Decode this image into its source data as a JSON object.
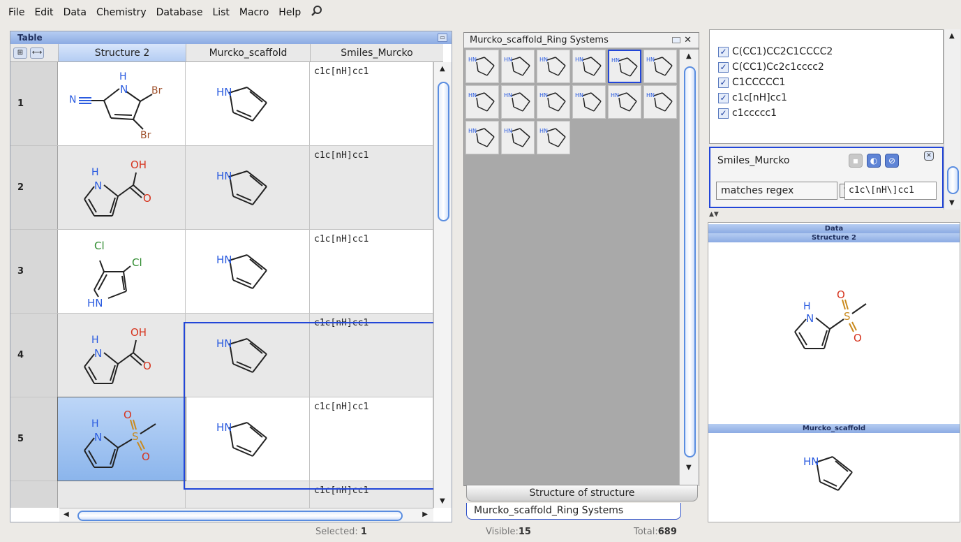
{
  "menu": [
    "File",
    "Edit",
    "Data",
    "Chemistry",
    "Database",
    "List",
    "Macro",
    "Help"
  ],
  "table": {
    "title": "Table",
    "columns": [
      "Structure 2",
      "Murcko_scaffold",
      "Smiles_Murcko"
    ],
    "rows": [
      {
        "num": "1",
        "smiles": "c1c[nH]cc1",
        "mol": {
          "atoms": [
            "H",
            "N",
            "Br",
            "N",
            "Br"
          ]
        }
      },
      {
        "num": "2",
        "smiles": "c1c[nH]cc1",
        "mol": {
          "atoms": [
            "H",
            "N",
            "OH",
            "O"
          ]
        }
      },
      {
        "num": "3",
        "smiles": "c1c[nH]cc1",
        "mol": {
          "atoms": [
            "Cl",
            "Cl",
            "HN"
          ]
        }
      },
      {
        "num": "4",
        "smiles": "c1c[nH]cc1",
        "mol": {
          "atoms": [
            "H",
            "N",
            "OH",
            "O"
          ]
        }
      },
      {
        "num": "5",
        "smiles": "c1c[nH]cc1",
        "mol": {
          "atoms": [
            "H",
            "N",
            "O",
            "S",
            "O"
          ]
        }
      },
      {
        "num": "",
        "smiles": "c1c[nH]cc1"
      }
    ],
    "scaffold_label": "HN"
  },
  "thumbs": {
    "title": "Murcko_scaffold_Ring Systems",
    "label": "HN",
    "count": 15
  },
  "tabs": {
    "structure": "Structure of structure",
    "murcko": "Murcko_scaffold_Ring Systems"
  },
  "list": {
    "items": [
      "C(CC1)CC2C1CCCC2",
      "C(CC1)Cc2c1cccc2",
      "C1CCCCC1",
      "c1c[nH]cc1",
      "c1ccccc1"
    ]
  },
  "filter": {
    "title": "Smiles_Murcko",
    "operator": "matches regex",
    "value": "c1c\\[nH\\]cc1"
  },
  "data_panel": {
    "title": "Data",
    "field1": "Structure 2",
    "field2": "Murcko_scaffold",
    "mol_atoms": [
      "H",
      "N",
      "O",
      "S",
      "O"
    ],
    "scaffold_label": "HN"
  },
  "status": {
    "selected_label": "Selected:",
    "selected": "1",
    "visible_label": "Visible:",
    "visible": "15",
    "total_label": "Total:",
    "total": "689"
  },
  "colors": {
    "accent": "#2246d8",
    "header": "#8cabe3",
    "selection": "#bdd6f7"
  }
}
